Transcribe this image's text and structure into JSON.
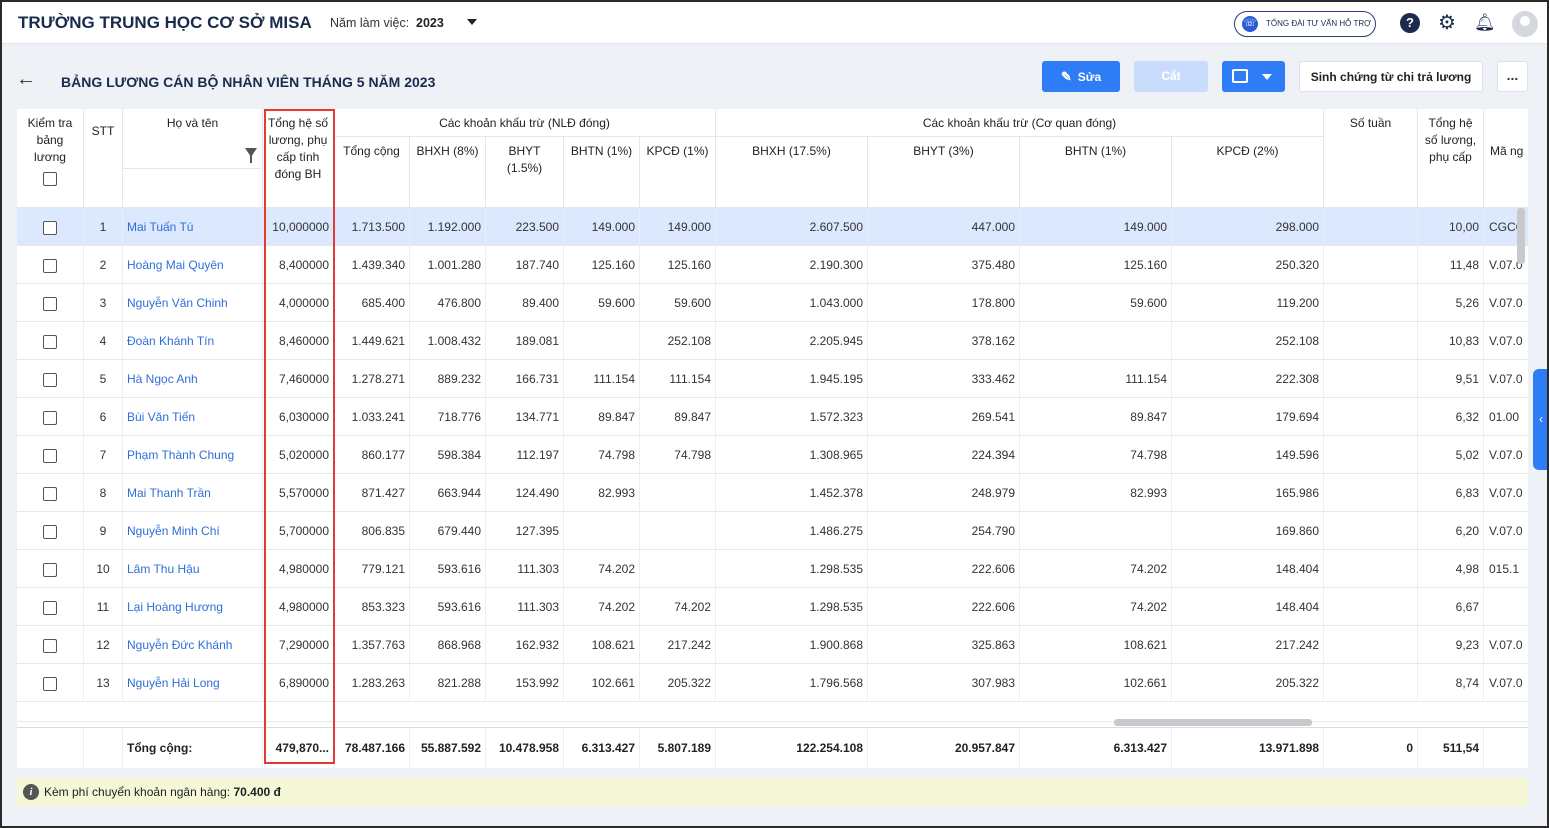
{
  "app": {
    "school_name": "TRƯỜNG TRUNG HỌC CƠ SỞ MISA",
    "year_label": "Năm làm việc:",
    "year_value": "2023",
    "support_label": "TỔNG ĐÀI TƯ VẤN HỖ TRỢ"
  },
  "toolbar": {
    "title": "BẢNG LƯƠNG CÁN BỘ NHÂN VIÊN THÁNG 5 NĂM 2023",
    "edit_label": "Sửa",
    "cut_label": "Cắt",
    "generate_label": "Sinh chứng từ chi trả lương",
    "more_label": "..."
  },
  "columns": {
    "check": "Kiểm tra bảng lương",
    "stt": "STT",
    "name": "Họ và tên",
    "coef": "Tổng hệ số lương, phụ cấp tính đóng BH",
    "group_employee": "Các khoản khấu trừ (NLĐ đóng)",
    "emp_total": "Tổng cộng",
    "emp_bhxh": "BHXH (8%)",
    "emp_bhyt": "BHYT (1.5%)",
    "emp_bhtn": "BHTN (1%)",
    "emp_kpcd": "KPCĐ (1%)",
    "group_agency": "Các khoản khấu trừ (Cơ quan đóng)",
    "ag_bhxh": "BHXH (17.5%)",
    "ag_bhyt": "BHYT (3%)",
    "ag_bhtn": "BHTN (1%)",
    "ag_kpcd": "KPCĐ (2%)",
    "weeks": "Số tuần",
    "coef2": "Tổng hệ số lương, phụ cấp",
    "code": "Mã ng"
  },
  "rows": [
    {
      "stt": "1",
      "name": "Mai Tuấn Tú",
      "coef": "10,000000",
      "emp_total": "1.713.500",
      "emp_bhxh": "1.192.000",
      "emp_bhyt": "223.500",
      "emp_bhtn": "149.000",
      "emp_kpcd": "149.000",
      "ag_bhxh": "2.607.500",
      "ag_bhyt": "447.000",
      "ag_bhtn": "149.000",
      "ag_kpcd": "298.000",
      "weeks": "",
      "coef2": "10,00",
      "code": "CGCC"
    },
    {
      "stt": "2",
      "name": "Hoàng Mai Quyên",
      "coef": "8,400000",
      "emp_total": "1.439.340",
      "emp_bhxh": "1.001.280",
      "emp_bhyt": "187.740",
      "emp_bhtn": "125.160",
      "emp_kpcd": "125.160",
      "ag_bhxh": "2.190.300",
      "ag_bhyt": "375.480",
      "ag_bhtn": "125.160",
      "ag_kpcd": "250.320",
      "weeks": "",
      "coef2": "11,48",
      "code": "V.07.0"
    },
    {
      "stt": "3",
      "name": "Nguyễn Văn Chinh",
      "coef": "4,000000",
      "emp_total": "685.400",
      "emp_bhxh": "476.800",
      "emp_bhyt": "89.400",
      "emp_bhtn": "59.600",
      "emp_kpcd": "59.600",
      "ag_bhxh": "1.043.000",
      "ag_bhyt": "178.800",
      "ag_bhtn": "59.600",
      "ag_kpcd": "119.200",
      "weeks": "",
      "coef2": "5,26",
      "code": "V.07.0"
    },
    {
      "stt": "4",
      "name": "Đoàn Khánh Tín",
      "coef": "8,460000",
      "emp_total": "1.449.621",
      "emp_bhxh": "1.008.432",
      "emp_bhyt": "189.081",
      "emp_bhtn": "",
      "emp_kpcd": "252.108",
      "ag_bhxh": "2.205.945",
      "ag_bhyt": "378.162",
      "ag_bhtn": "",
      "ag_kpcd": "252.108",
      "weeks": "",
      "coef2": "10,83",
      "code": "V.07.0"
    },
    {
      "stt": "5",
      "name": "Hà Ngọc Anh",
      "coef": "7,460000",
      "emp_total": "1.278.271",
      "emp_bhxh": "889.232",
      "emp_bhyt": "166.731",
      "emp_bhtn": "111.154",
      "emp_kpcd": "111.154",
      "ag_bhxh": "1.945.195",
      "ag_bhyt": "333.462",
      "ag_bhtn": "111.154",
      "ag_kpcd": "222.308",
      "weeks": "",
      "coef2": "9,51",
      "code": "V.07.0"
    },
    {
      "stt": "6",
      "name": "Bùi Văn Tiến",
      "coef": "6,030000",
      "emp_total": "1.033.241",
      "emp_bhxh": "718.776",
      "emp_bhyt": "134.771",
      "emp_bhtn": "89.847",
      "emp_kpcd": "89.847",
      "ag_bhxh": "1.572.323",
      "ag_bhyt": "269.541",
      "ag_bhtn": "89.847",
      "ag_kpcd": "179.694",
      "weeks": "",
      "coef2": "6,32",
      "code": "01.00"
    },
    {
      "stt": "7",
      "name": "Phạm Thành Chung",
      "coef": "5,020000",
      "emp_total": "860.177",
      "emp_bhxh": "598.384",
      "emp_bhyt": "112.197",
      "emp_bhtn": "74.798",
      "emp_kpcd": "74.798",
      "ag_bhxh": "1.308.965",
      "ag_bhyt": "224.394",
      "ag_bhtn": "74.798",
      "ag_kpcd": "149.596",
      "weeks": "",
      "coef2": "5,02",
      "code": "V.07.0"
    },
    {
      "stt": "8",
      "name": "Mai Thanh Trần",
      "coef": "5,570000",
      "emp_total": "871.427",
      "emp_bhxh": "663.944",
      "emp_bhyt": "124.490",
      "emp_bhtn": "82.993",
      "emp_kpcd": "",
      "ag_bhxh": "1.452.378",
      "ag_bhyt": "248.979",
      "ag_bhtn": "82.993",
      "ag_kpcd": "165.986",
      "weeks": "",
      "coef2": "6,83",
      "code": "V.07.0"
    },
    {
      "stt": "9",
      "name": "Nguyễn Minh Chí",
      "coef": "5,700000",
      "emp_total": "806.835",
      "emp_bhxh": "679.440",
      "emp_bhyt": "127.395",
      "emp_bhtn": "",
      "emp_kpcd": "",
      "ag_bhxh": "1.486.275",
      "ag_bhyt": "254.790",
      "ag_bhtn": "",
      "ag_kpcd": "169.860",
      "weeks": "",
      "coef2": "6,20",
      "code": "V.07.0"
    },
    {
      "stt": "10",
      "name": "Lâm Thu Hậu",
      "coef": "4,980000",
      "emp_total": "779.121",
      "emp_bhxh": "593.616",
      "emp_bhyt": "111.303",
      "emp_bhtn": "74.202",
      "emp_kpcd": "",
      "ag_bhxh": "1.298.535",
      "ag_bhyt": "222.606",
      "ag_bhtn": "74.202",
      "ag_kpcd": "148.404",
      "weeks": "",
      "coef2": "4,98",
      "code": "015.1"
    },
    {
      "stt": "11",
      "name": "Lại Hoàng Hương",
      "coef": "4,980000",
      "emp_total": "853.323",
      "emp_bhxh": "593.616",
      "emp_bhyt": "111.303",
      "emp_bhtn": "74.202",
      "emp_kpcd": "74.202",
      "ag_bhxh": "1.298.535",
      "ag_bhyt": "222.606",
      "ag_bhtn": "74.202",
      "ag_kpcd": "148.404",
      "weeks": "",
      "coef2": "6,67",
      "code": ""
    },
    {
      "stt": "12",
      "name": "Nguyễn Đức Khánh",
      "coef": "7,290000",
      "emp_total": "1.357.763",
      "emp_bhxh": "868.968",
      "emp_bhyt": "162.932",
      "emp_bhtn": "108.621",
      "emp_kpcd": "217.242",
      "ag_bhxh": "1.900.868",
      "ag_bhyt": "325.863",
      "ag_bhtn": "108.621",
      "ag_kpcd": "217.242",
      "weeks": "",
      "coef2": "9,23",
      "code": "V.07.0"
    },
    {
      "stt": "13",
      "name": "Nguyễn Hải Long",
      "coef": "6,890000",
      "emp_total": "1.283.263",
      "emp_bhxh": "821.288",
      "emp_bhyt": "153.992",
      "emp_bhtn": "102.661",
      "emp_kpcd": "205.322",
      "ag_bhxh": "1.796.568",
      "ag_bhyt": "307.983",
      "ag_bhtn": "102.661",
      "ag_kpcd": "205.322",
      "weeks": "",
      "coef2": "8,74",
      "code": "V.07.0"
    }
  ],
  "totals": {
    "label": "Tổng cộng:",
    "coef": "479,870...",
    "emp_total": "78.487.166",
    "emp_bhxh": "55.887.592",
    "emp_bhyt": "10.478.958",
    "emp_bhtn": "6.313.427",
    "emp_kpcd": "5.807.189",
    "ag_bhxh": "122.254.108",
    "ag_bhyt": "20.957.847",
    "ag_bhtn": "6.313.427",
    "ag_kpcd": "13.971.898",
    "weeks": "0",
    "coef2": "511,54"
  },
  "footer": {
    "note_label": "Kèm phí chuyển khoản ngân hàng:",
    "note_value": "70.400 đ"
  },
  "colors": {
    "primary": "#2e7cf6",
    "link": "#2e6fd8",
    "highlight_border": "#e53935",
    "selected_row": "#dbe8fd",
    "note_bg": "#f5f8d6"
  }
}
